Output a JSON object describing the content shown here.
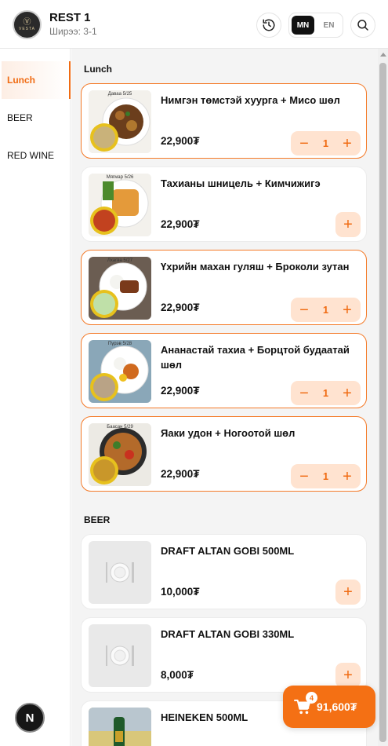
{
  "header": {
    "restaurant_name": "REST 1",
    "table_label": "Ширээ: 3-1",
    "logo_mark": "Ⓥ",
    "logo_text": "VESTA",
    "languages": [
      {
        "code": "MN",
        "active": true
      },
      {
        "code": "EN",
        "active": false
      }
    ],
    "icons": {
      "history": "history-icon",
      "search": "search-icon"
    }
  },
  "sidebar": {
    "categories": [
      {
        "label": "Lunch",
        "active": true
      },
      {
        "label": "BEER",
        "active": false
      },
      {
        "label": "RED WINE",
        "active": false
      }
    ]
  },
  "sections": [
    {
      "title": "Lunch",
      "items": [
        {
          "name": "Нимгэн төмстэй хуурга + Мисо шөл",
          "price": "22,900₮",
          "day": "Даваа 5/25",
          "quantity": "1"
        },
        {
          "name": "Тахианы шницель + Кимчижигэ",
          "price": "22,900₮",
          "day": "Мягмар 5/26",
          "quantity": null
        },
        {
          "name": "Үхрийн махан гуляш + Броколи зутан",
          "price": "22,900₮",
          "day": "Лхагва 5/27",
          "quantity": "1"
        },
        {
          "name": "Ананастай тахиа + Борцтой будаатай шөл",
          "price": "22,900₮",
          "day": "Пүрэв 5/28",
          "quantity": "1"
        },
        {
          "name": "Яаки удон + Ногоотой шөл",
          "price": "22,900₮",
          "day": "Баасан 5/29",
          "quantity": "1"
        }
      ]
    },
    {
      "title": "BEER",
      "items": [
        {
          "name": "DRAFT ALTAN GOBI 500ML",
          "price": "10,000₮",
          "quantity": null
        },
        {
          "name": "DRAFT ALTAN GOBI 330ML",
          "price": "8,000₮",
          "quantity": null
        },
        {
          "name": "HEINEKEN 500ML",
          "price": "",
          "quantity": null
        }
      ]
    }
  ],
  "controls": {
    "minus": "−",
    "plus": "+"
  },
  "cart": {
    "count": "4",
    "total": "91,600₮"
  },
  "floating_button": {
    "label": "N"
  },
  "colors": {
    "accent": "#f47014",
    "accent_light": "#ffe3d0"
  }
}
